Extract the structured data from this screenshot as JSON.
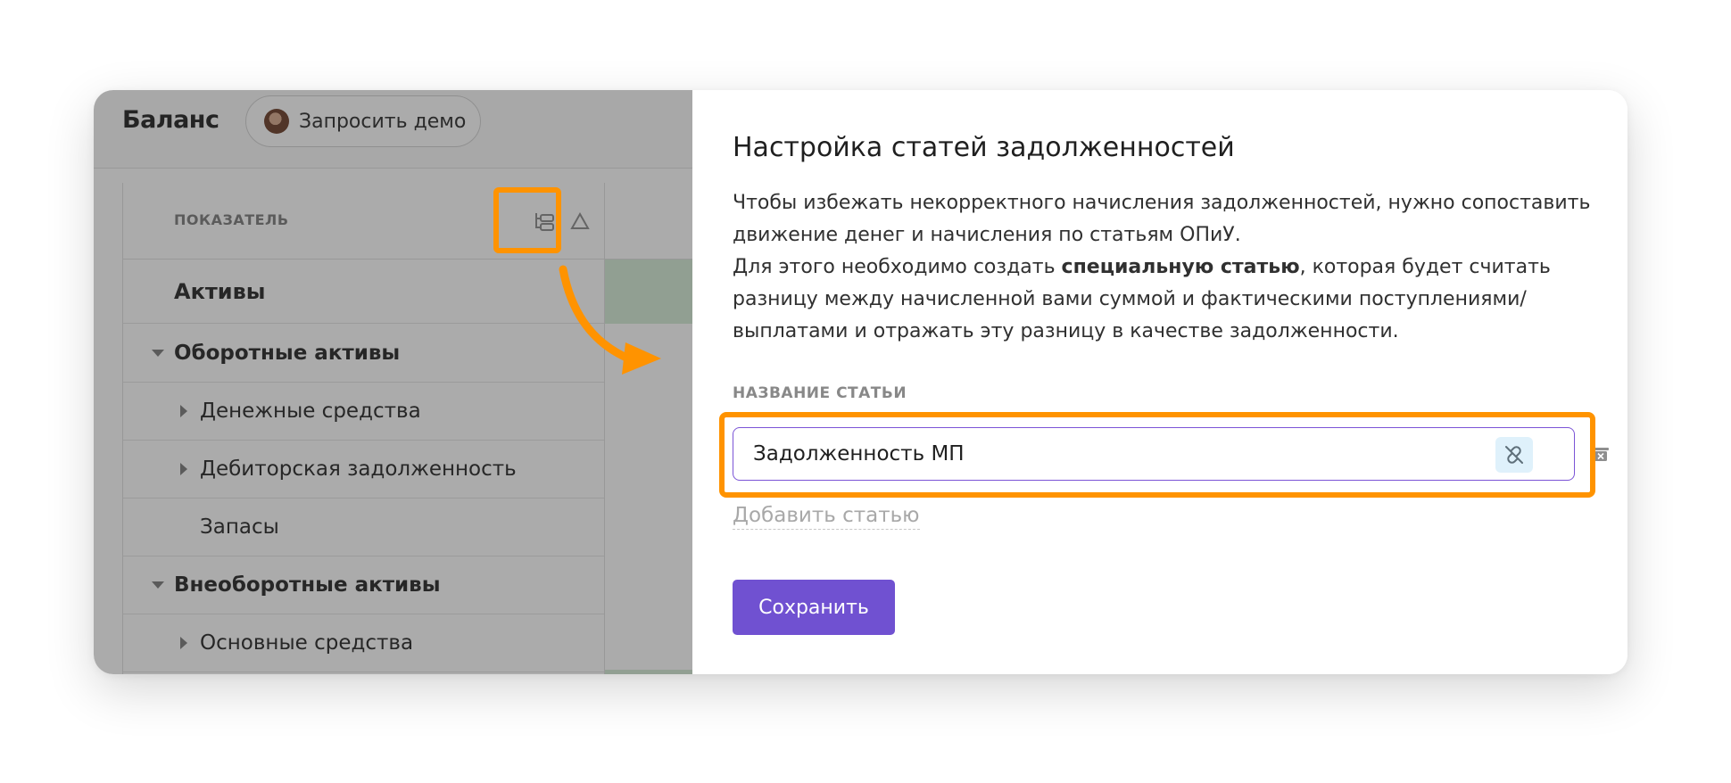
{
  "left": {
    "title": "Баланс",
    "demo_button": "Запросить демо",
    "column_header": "ПОКАЗАТЕЛЬ",
    "rows": [
      {
        "label": "Активы",
        "level": "header",
        "caret": "none",
        "bold": true
      },
      {
        "label": "Оборотные активы",
        "level": "group",
        "caret": "down",
        "bold": true
      },
      {
        "label": "Денежные средства",
        "level": "child",
        "caret": "right",
        "bold": false
      },
      {
        "label": "Дебиторская задолженность",
        "level": "child",
        "caret": "right",
        "bold": false
      },
      {
        "label": "Запасы",
        "level": "child",
        "caret": "none",
        "bold": false
      },
      {
        "label": "Внеоборотные активы",
        "level": "group",
        "caret": "down",
        "bold": true
      },
      {
        "label": "Основные средства",
        "level": "child",
        "caret": "right",
        "bold": false
      }
    ]
  },
  "panel": {
    "title": "Настройка статей задолженностей",
    "para1": "Чтобы избежать некорректного начисления задолженностей, нужно сопоставить движение денег и начисления по статьям ОПиУ.",
    "para2_before": "Для этого необходимо создать ",
    "para2_bold": "специальную статью",
    "para2_after": ", которая будет считать разницу между начисленной вами суммой и фактическими поступлениями/выплатами и отражать эту разницу в качестве задолженности.",
    "field_label": "НАЗВАНИЕ СТАТЬИ",
    "input_value": "Задолженность МП",
    "add_link": "Добавить статью",
    "save_button": "Сохранить"
  },
  "icons": {
    "tree": "tree-view-icon",
    "sort": "sort-triangle-icon",
    "unlink": "unlink-icon",
    "trash": "trash-icon",
    "arrow": "curved-arrow-icon"
  },
  "colors": {
    "accent_purple": "#7051d1",
    "highlight_orange": "#ff9300",
    "unlink_bg": "#dff1fb",
    "cell_green": "#d4ecd6"
  }
}
